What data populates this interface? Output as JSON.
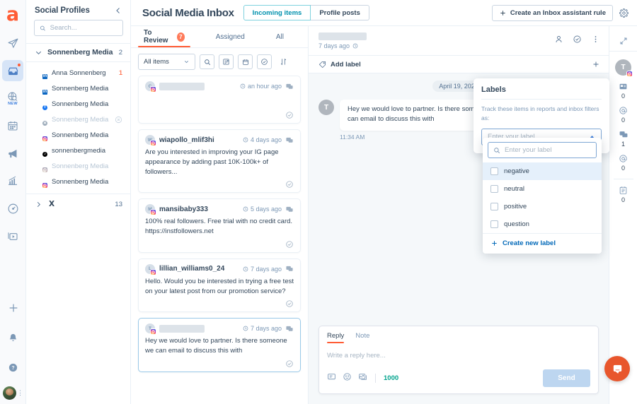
{
  "rail": {
    "logo": "a",
    "items": [
      {
        "name": "send-icon",
        "label": "Publish"
      },
      {
        "name": "inbox-icon",
        "label": "Inbox",
        "active": true,
        "dot": true
      },
      {
        "name": "social-listening-icon",
        "label": "Listening",
        "tag": "NEW"
      },
      {
        "name": "calendar-icon",
        "label": "Calendar"
      },
      {
        "name": "megaphone-icon",
        "label": "Campaigns"
      },
      {
        "name": "analytics-icon",
        "label": "Analytics"
      },
      {
        "name": "monitoring-icon",
        "label": "Monitoring"
      },
      {
        "name": "media-library-icon",
        "label": "Media library"
      }
    ],
    "bottom": [
      {
        "name": "add-icon",
        "label": "Create"
      },
      {
        "name": "bell-icon",
        "label": "Notifications"
      },
      {
        "name": "help-icon",
        "label": "Help"
      }
    ]
  },
  "profiles": {
    "title": "Social Profiles",
    "collapse_icon": "chevron-left-icon",
    "search": {
      "placeholder": "Search...",
      "value": ""
    },
    "group": {
      "name": "Sonnenberg Media",
      "count": "2"
    },
    "items": [
      {
        "name": "Anna Sonnenberg",
        "network": "li",
        "badge": "1",
        "muted": false,
        "kind": "pers"
      },
      {
        "name": "Sonnenberg Media",
        "network": "li",
        "badge": "",
        "muted": false,
        "kind": "biz"
      },
      {
        "name": "Sonnenberg Media",
        "network": "fb",
        "badge": "",
        "muted": false,
        "kind": "biz"
      },
      {
        "name": "Sonnenberg Media",
        "network": "xx",
        "badge": "",
        "muted": true,
        "kind": "pers",
        "remove": true
      },
      {
        "name": "Sonnenberg Media",
        "network": "ig",
        "badge": "",
        "muted": false,
        "kind": "biz"
      },
      {
        "name": "sonnenbergmedia",
        "network": "tt",
        "badge": "",
        "muted": false,
        "kind": "biz"
      },
      {
        "name": "Sonnenberg Media",
        "network": "ig",
        "badge": "",
        "muted": true,
        "kind": "biz"
      },
      {
        "name": "Sonnenberg Media",
        "network": "ig",
        "badge": "",
        "muted": false,
        "kind": "biz"
      }
    ],
    "x_group": {
      "name": "X",
      "count": "13"
    }
  },
  "header": {
    "title": "Social Media Inbox",
    "segments": [
      {
        "label": "Incoming items",
        "active": true
      },
      {
        "label": "Profile posts",
        "active": false
      }
    ],
    "rule_button": "Create an Inbox assistant rule",
    "gear_icon": "gear-icon"
  },
  "list": {
    "tabs": [
      {
        "label": "To Review",
        "badge": "7",
        "active": true
      },
      {
        "label": "Assigned",
        "badge": "",
        "active": false
      },
      {
        "label": "All",
        "badge": "",
        "active": false
      }
    ],
    "filter_select": "All items",
    "toolbar_icons": [
      "search-icon",
      "assign-icon",
      "calendar-icon",
      "check-circle-icon",
      "sort-icon"
    ],
    "conversations": [
      {
        "author": "",
        "redacted": true,
        "time": "an hour ago",
        "text": "",
        "selected": false,
        "empty": true
      },
      {
        "author": "wiapollo_mlif3hi",
        "redacted": false,
        "time": "4 days ago",
        "text": "Are you interested in improving your IG page appearance by adding past 10K-100k+ of followers...",
        "selected": false,
        "empty": false
      },
      {
        "author": "mansibaby333",
        "redacted": false,
        "time": "5 days ago",
        "text": "100% real followers.  Free trial with no credit card. https://instfollowers.net",
        "selected": false,
        "empty": false
      },
      {
        "author": "lillian_williams0_24",
        "redacted": false,
        "time": "7 days ago",
        "text": "Hello. Would you be interested in trying a free test on your latest post from our promotion service?",
        "selected": false,
        "empty": false
      },
      {
        "author": "",
        "redacted": true,
        "time": "7 days ago",
        "text": "Hey we would love to partner. Is there someone we can email to discuss this with",
        "selected": true,
        "empty": false
      }
    ]
  },
  "thread": {
    "title_redacted": true,
    "subtitle": "7 days ago",
    "actions": [
      "assign-user-icon",
      "mark-done-icon",
      "more-menu-icon"
    ],
    "label_bar": {
      "icon": "tag-icon",
      "text": "Add label",
      "add_icon": "plus-icon"
    },
    "date_chip": "April 19, 2024",
    "messages": [
      {
        "avatar_initial": "T",
        "text": "Hey we would love to partner. Is there someone we can email to discuss this with",
        "time": "11:34 AM"
      }
    ],
    "composer": {
      "tabs": [
        {
          "label": "Reply",
          "active": true
        },
        {
          "label": "Note",
          "active": false
        }
      ],
      "placeholder": "Write a reply here...",
      "icons": [
        "snippet-icon",
        "emoji-icon",
        "image-icon"
      ],
      "char_count": "1000",
      "send_label": "Send"
    }
  },
  "labels_popover": {
    "title": "Labels",
    "description": "Track these items in reports and inbox filters as:",
    "select_placeholder": "Enter your label",
    "caret_icon": "chevron-up-icon",
    "search_placeholder": "Enter your label",
    "options": [
      {
        "label": "negative",
        "highlighted": true
      },
      {
        "label": "neutral",
        "highlighted": false
      },
      {
        "label": "positive",
        "highlighted": false
      },
      {
        "label": "question",
        "highlighted": false
      }
    ],
    "create_new": "Create new label"
  },
  "right_rail": {
    "expand_icon": "expand-icon",
    "avatar_initial": "T",
    "stats": [
      {
        "icon": "post-icon",
        "value": "0"
      },
      {
        "icon": "mention-icon",
        "value": "0"
      },
      {
        "icon": "comment-icon",
        "value": "1"
      },
      {
        "icon": "at-icon",
        "value": "0"
      }
    ],
    "stats2": [
      {
        "icon": "note-icon",
        "value": "0"
      }
    ]
  },
  "fab": {
    "icon": "chat-bubble-icon"
  },
  "colors": {
    "accent_orange": "#ff5c35",
    "link_blue": "#0068b8",
    "teal": "#0091ae",
    "text": "#33475b",
    "muted": "#7c98b6"
  }
}
